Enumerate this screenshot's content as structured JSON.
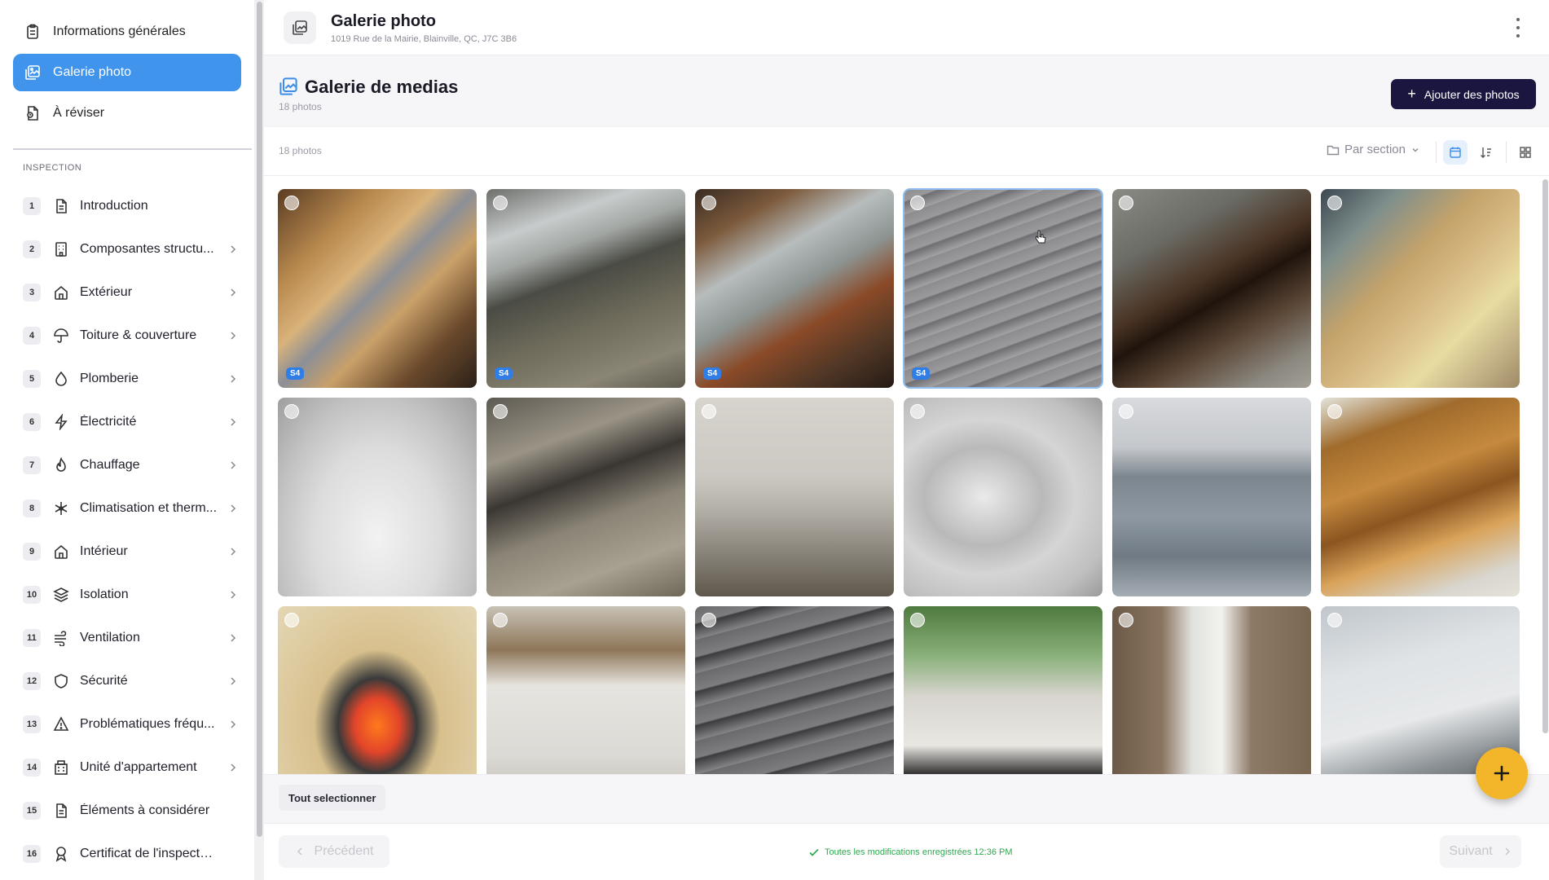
{
  "sidebar": {
    "top_items": [
      {
        "label": "Informations générales",
        "icon": "clipboard-icon",
        "active": false
      },
      {
        "label": "Galerie photo",
        "icon": "gallery-icon",
        "active": true
      },
      {
        "label": "À réviser",
        "icon": "document-review-icon",
        "active": false
      }
    ],
    "section_label": "INSPECTION",
    "inspection_items": [
      {
        "num": "1",
        "label": "Introduction",
        "icon": "document-icon",
        "chevron": false
      },
      {
        "num": "2",
        "label": "Composantes structu...",
        "icon": "building-icon",
        "chevron": true
      },
      {
        "num": "3",
        "label": "Extérieur",
        "icon": "house-icon",
        "chevron": true
      },
      {
        "num": "4",
        "label": "Toiture & couverture",
        "icon": "umbrella-icon",
        "chevron": true
      },
      {
        "num": "5",
        "label": "Plomberie",
        "icon": "droplet-icon",
        "chevron": true
      },
      {
        "num": "6",
        "label": "Électricité",
        "icon": "bolt-icon",
        "chevron": true
      },
      {
        "num": "7",
        "label": "Chauffage",
        "icon": "flame-icon",
        "chevron": true
      },
      {
        "num": "8",
        "label": "Climatisation et therm...",
        "icon": "snowflake-icon",
        "chevron": true
      },
      {
        "num": "9",
        "label": "Intérieur",
        "icon": "house-icon",
        "chevron": true
      },
      {
        "num": "10",
        "label": "Isolation",
        "icon": "layers-icon",
        "chevron": true
      },
      {
        "num": "11",
        "label": "Ventilation",
        "icon": "wind-icon",
        "chevron": true
      },
      {
        "num": "12",
        "label": "Sécurité",
        "icon": "shield-icon",
        "chevron": true
      },
      {
        "num": "13",
        "label": "Problématiques fréqu...",
        "icon": "warning-icon",
        "chevron": true
      },
      {
        "num": "14",
        "label": "Unité d'appartement",
        "icon": "apartment-icon",
        "chevron": true
      },
      {
        "num": "15",
        "label": "Éléments à considérer",
        "icon": "document-icon",
        "chevron": false
      },
      {
        "num": "16",
        "label": "Certificat de l'inspecteur",
        "icon": "award-icon",
        "chevron": false
      }
    ]
  },
  "header": {
    "title": "Galerie photo",
    "address": "1019 Rue de la Mairie, Blainville, QC, J7C 3B6"
  },
  "gallery": {
    "title": "Galerie de medias",
    "count": "18 photos",
    "add_button": "Ajouter des photos",
    "toolbar_count": "18 photos",
    "group_by": "Par section"
  },
  "photos": [
    {
      "badge": "S4",
      "desc": "attic-truss-plate",
      "selected": false
    },
    {
      "badge": "S4",
      "desc": "crawlspace-duct",
      "selected": false
    },
    {
      "badge": "S4",
      "desc": "rusted-pipe",
      "selected": false
    },
    {
      "badge": "S4",
      "desc": "roof-shingle-ridge",
      "selected": true
    },
    {
      "badge": "",
      "desc": "rotten-roof-edge",
      "selected": false
    },
    {
      "badge": "",
      "desc": "moldy-attic-sheathing",
      "selected": false
    },
    {
      "badge": "",
      "desc": "bathroom-sink",
      "selected": false
    },
    {
      "badge": "",
      "desc": "crawlspace-pipe",
      "selected": false
    },
    {
      "badge": "",
      "desc": "foundation-crack",
      "selected": false
    },
    {
      "badge": "",
      "desc": "shower-faucet",
      "selected": false
    },
    {
      "badge": "",
      "desc": "metal-roof",
      "selected": false
    },
    {
      "badge": "",
      "desc": "ceiling-joists",
      "selected": false
    },
    {
      "badge": "",
      "desc": "thermal-camera",
      "selected": false
    },
    {
      "badge": "",
      "desc": "garage-door",
      "selected": false
    },
    {
      "badge": "",
      "desc": "lifted-shingles",
      "selected": false
    },
    {
      "badge": "",
      "desc": "window-sill",
      "selected": false
    },
    {
      "badge": "",
      "desc": "drain-pipe",
      "selected": false
    },
    {
      "badge": "",
      "desc": "window-frame",
      "selected": false
    }
  ],
  "bottom": {
    "select_all": "Tout selectionner",
    "prev": "Précédent",
    "next": "Suivant",
    "save_status": "Toutes les modifications enregistrées 12:36 PM"
  },
  "colors": {
    "accent": "#4094ec",
    "primary_button": "#1b1640",
    "fab": "#f3b52a",
    "success": "#2fa84f"
  }
}
